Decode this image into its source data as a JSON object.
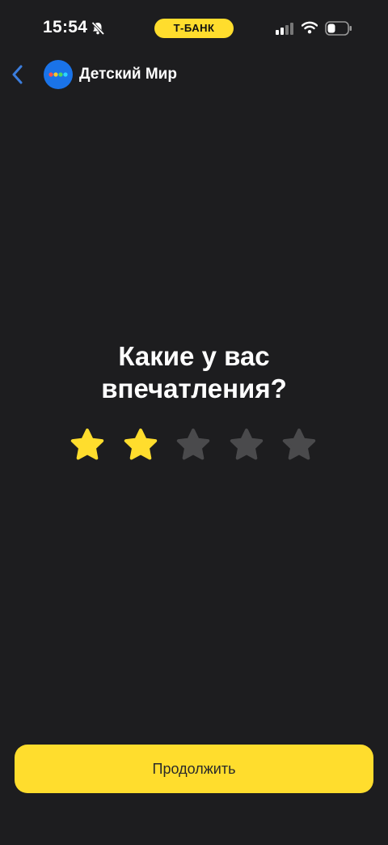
{
  "status_bar": {
    "time": "15:54",
    "carrier_badge": "Т-БАНК",
    "icons": [
      "bell-slash-icon",
      "signal-icon",
      "wifi-icon",
      "battery-icon"
    ]
  },
  "header": {
    "shop_name": "Детский Мир",
    "back_icon": "chevron-left-icon"
  },
  "rating": {
    "question": "Какие у вас впечатления?",
    "selected": 2,
    "max": 5
  },
  "continue_label": "Продолжить",
  "colors": {
    "background": "#1d1d1f",
    "accent": "#ffdd2d",
    "back_arrow": "#3b7ddd",
    "avatar": "#1a73e8",
    "star_active": "#ffdd2d",
    "star_inactive": "#4a4a4c"
  }
}
